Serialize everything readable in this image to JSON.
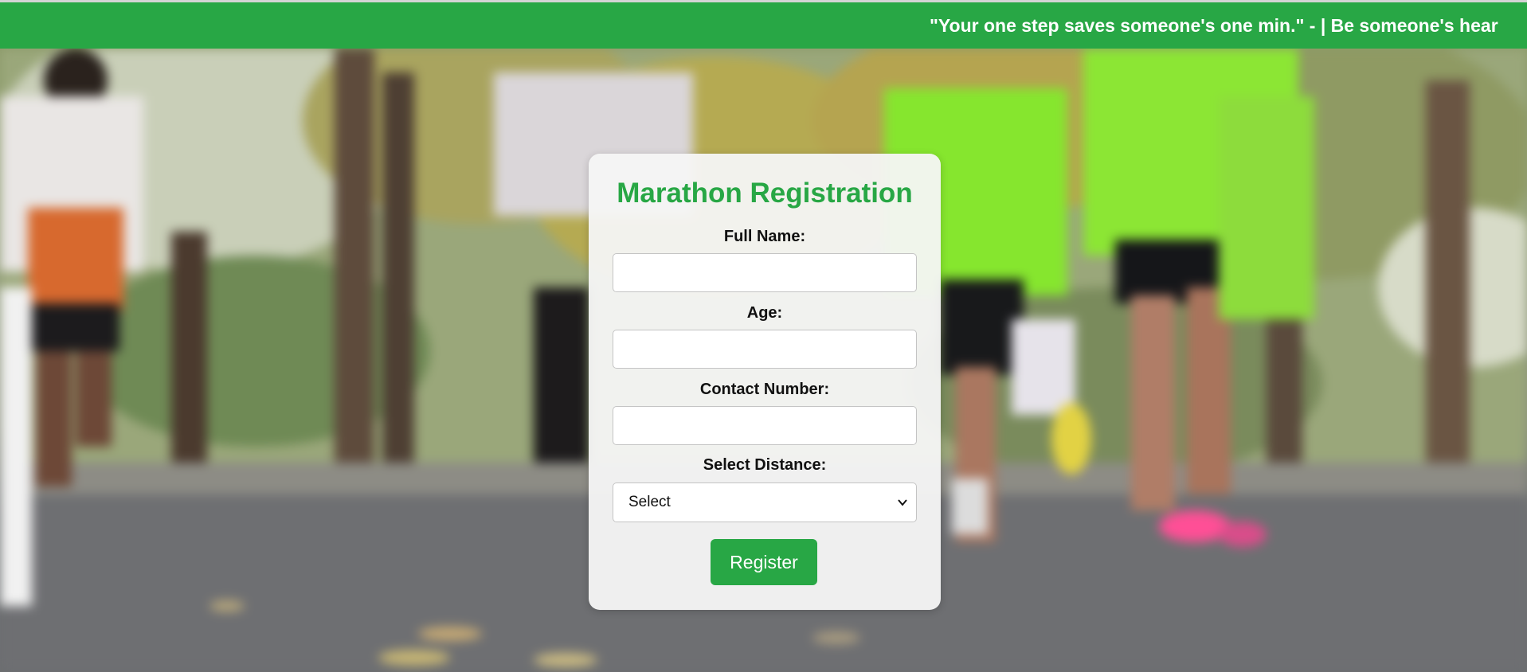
{
  "ticker": {
    "text": "\"Your one step saves someone's one min.\" -  | Be someone's hear"
  },
  "form": {
    "title": "Marathon Registration",
    "full_name_label": "Full Name:",
    "full_name_value": "",
    "age_label": "Age:",
    "age_value": "",
    "contact_label": "Contact Number:",
    "contact_value": "",
    "distance_label": "Select Distance:",
    "distance_selected": "Select",
    "register_label": "Register"
  },
  "colors": {
    "accent": "#28a745",
    "card_bg": "#f6f6f6",
    "text": "#111111"
  },
  "icons": {
    "dropdown": "chevron-down-icon"
  }
}
